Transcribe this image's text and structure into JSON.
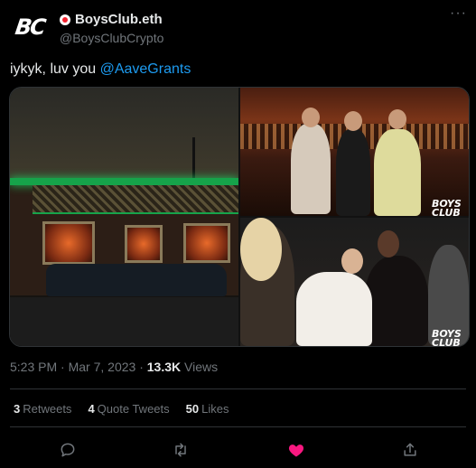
{
  "author": {
    "avatar_text": "BC",
    "display_name": "BoysClub.eth",
    "handle": "@BoysClubCrypto"
  },
  "tweet": {
    "text": "iykyk, luv you ",
    "mention": "@AaveGrants",
    "time": "5:23 PM",
    "separator": "·",
    "date": "Mar 7, 2023",
    "views_count": "13.3K",
    "views_label": "Views"
  },
  "media": {
    "watermark_line1": "BOYS",
    "watermark_line2": "CLUB"
  },
  "stats": {
    "retweets_count": "3",
    "retweets_label": "Retweets",
    "quotes_count": "4",
    "quotes_label": "Quote Tweets",
    "likes_count": "50",
    "likes_label": "Likes"
  },
  "icons": {
    "more": "more-dots-icon",
    "reply": "reply-icon",
    "retweet": "retweet-icon",
    "like": "heart-icon",
    "share": "share-icon"
  },
  "colors": {
    "background": "#000000",
    "text": "#e7e9ea",
    "muted": "#71767b",
    "link": "#1d9bf0",
    "like": "#f91880",
    "divider": "#2f3336"
  }
}
